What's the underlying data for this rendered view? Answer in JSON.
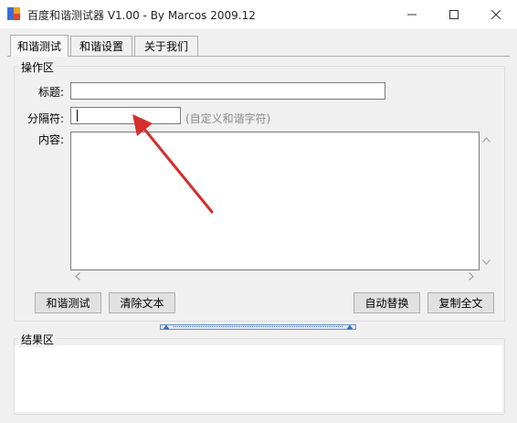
{
  "window": {
    "title": "百度和谐测试器 V1.00 - By Marcos 2009.12",
    "controls": {
      "minimize": "—",
      "maximize": "☐",
      "close": "✕"
    }
  },
  "tabs": [
    {
      "label": "和谐测试",
      "active": true
    },
    {
      "label": "和谐设置",
      "active": false
    },
    {
      "label": "关于我们",
      "active": false
    }
  ],
  "operation": {
    "group_label": "操作区",
    "title_label": "标题:",
    "title_value": "",
    "separator_label": "分隔符:",
    "separator_value": "",
    "separator_hint": "(自定义和谐字符)",
    "content_label": "内容:",
    "content_value": ""
  },
  "buttons": {
    "test": "和谐测试",
    "clear": "清除文本",
    "auto_replace": "自动替换",
    "copy_all": "复制全文"
  },
  "result": {
    "group_label": "结果区"
  },
  "colors": {
    "annotation_arrow": "#d32f2f",
    "splitter": "#6b8fbf"
  },
  "icons": {
    "app": "app-icon",
    "scroll_up": "scroll-up-icon",
    "scroll_down": "scroll-down-icon",
    "scroll_left": "scroll-left-icon",
    "scroll_right": "scroll-right-icon"
  }
}
